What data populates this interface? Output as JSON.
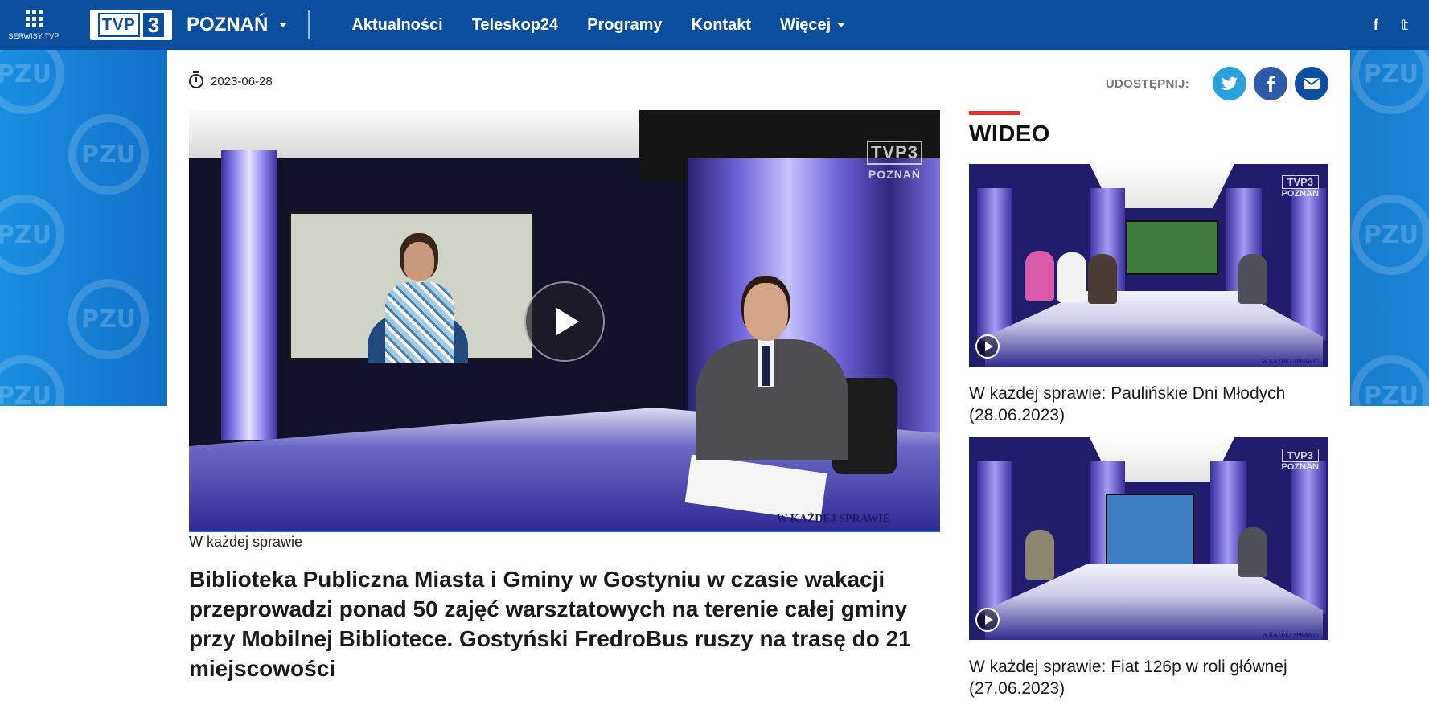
{
  "topnav": {
    "services_label": "SERWISY TVP",
    "logo_text": "TVP",
    "logo_number": "3",
    "region": "POZNAŃ",
    "links": [
      "Aktualności",
      "Teleskop24",
      "Programy",
      "Kontakt",
      "Więcej"
    ],
    "social": [
      "f",
      "𝕥"
    ]
  },
  "article": {
    "date": "2023-06-28",
    "share_label": "UDOSTĘPNIJ:",
    "share_buttons": [
      "twitter",
      "facebook",
      "email"
    ],
    "video_label": "W każdej sprawie",
    "video_logo_line1": "TVP3",
    "video_logo_line2": "POZNAŃ",
    "video_strip": "W KAŻDEJ SPRAWIE",
    "title": "Biblioteka Publiczna Miasta i Gminy w Gostyniu w czasie wakacji przeprowadzi ponad 50 zajęć warsztatowych na terenie całej gminy przy Mobilnej Bibliotece. Gostyński FredroBus ruszy na trasę do 21 miejscowości"
  },
  "sidebar": {
    "heading": "WIDEO",
    "items": [
      {
        "title": "W każdej sprawie: Paulińskie Dni Młodych (28.06.2023)",
        "logo1": "TVP3",
        "logo2": "POZNAŃ",
        "strip": "W KAŻDEJ SPRAWIE"
      },
      {
        "title": "W każdej sprawie: Fiat 126p w roli głównej (27.06.2023)",
        "logo1": "TVP3",
        "logo2": "POZNAŃ",
        "strip": "W KAŻDEJ SPRAWIE"
      }
    ]
  },
  "ad": {
    "brand_text": "PZU"
  },
  "colors": {
    "nav_bg": "#0b4e9e",
    "accent_red": "#e2312d",
    "twitter": "#2aa0dd",
    "facebook": "#2f5aa8"
  }
}
